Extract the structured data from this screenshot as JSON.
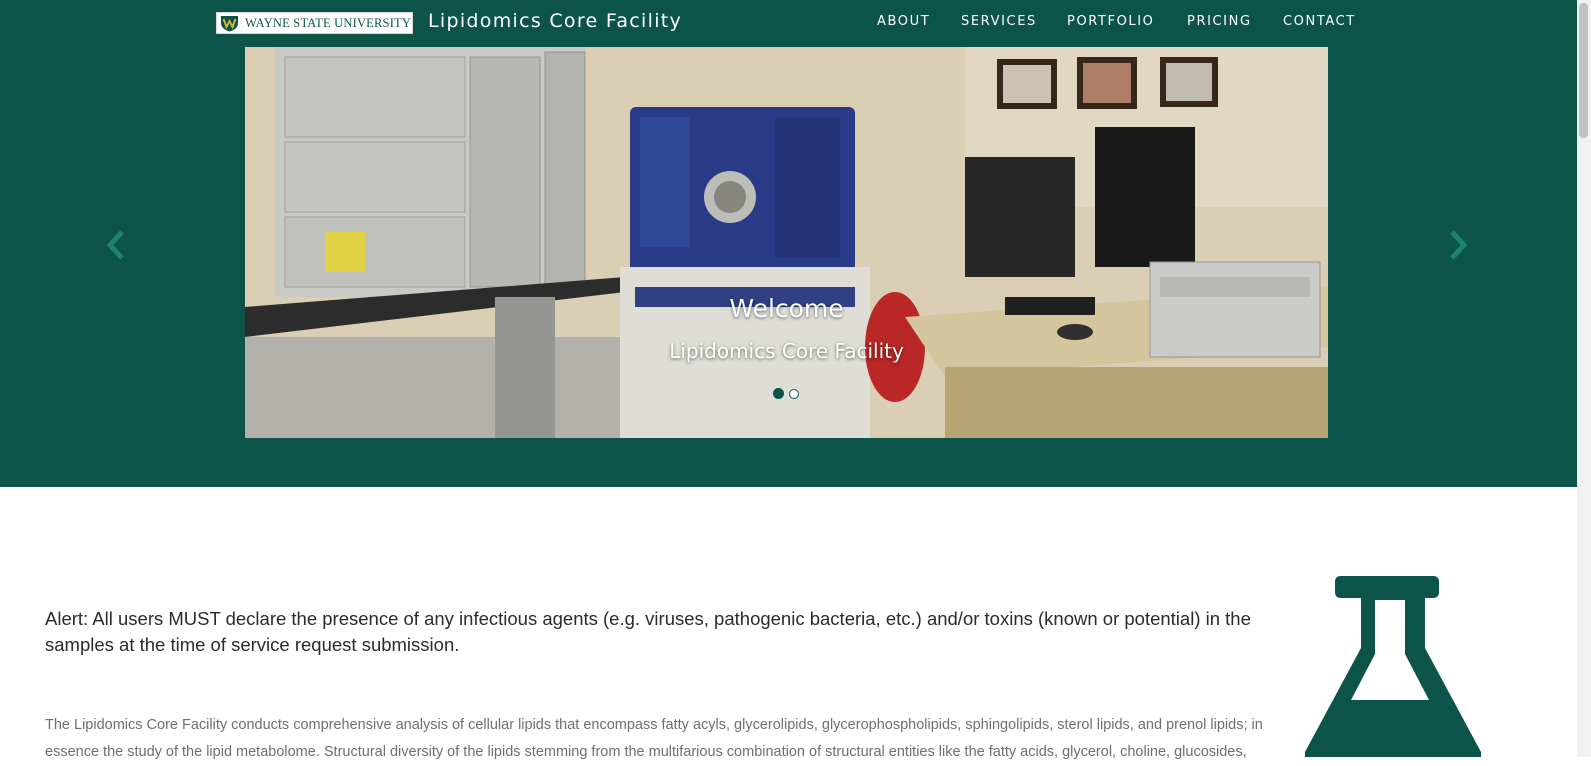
{
  "colors": {
    "brand": "#0c5449",
    "text_dark": "#2b2b2b",
    "text_muted": "#6f6f6f",
    "white": "#ffffff"
  },
  "navbar": {
    "logo_text": "WAYNE STATE UNIVERSITY",
    "logo_icon": "wsu-shield-icon",
    "brand": "Lipidomics Core Facility",
    "links": [
      "ABOUT",
      "SERVICES",
      "PORTFOLIO",
      "PRICING",
      "CONTACT"
    ]
  },
  "carousel": {
    "title": "Welcome",
    "subtitle": "Lipidomics Core Facility",
    "prev_icon": "chevron-left-icon",
    "next_icon": "chevron-right-icon",
    "slide_count": 2,
    "active_slide": 1
  },
  "content": {
    "alert": "Alert: All users MUST declare the presence of any infectious agents (e.g. viruses, pathogenic bacteria, etc.) and/or toxins (known or potential) in the samples at the time of service request submission.",
    "intro": "The Lipidomics Core Facility conducts comprehensive analysis of cellular lipids that encompass fatty acyls, glycerolipids, glycerophospholipids, sphingolipids, sterol lipids, and prenol lipids; in essence the study of the lipid metabolome. Structural diversity of the lipids stemming from the multifarious combination of structural entities like the fatty acids, glycerol, choline, glucosides,",
    "flask_icon": "flask-icon"
  }
}
